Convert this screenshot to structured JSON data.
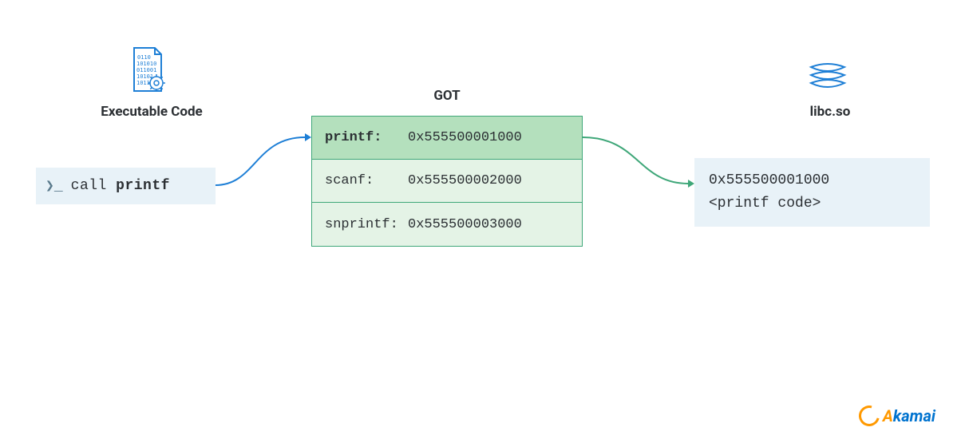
{
  "left": {
    "title": "Executable Code",
    "prompt": "❯_",
    "call_prefix": "call ",
    "call_fn": "printf"
  },
  "got": {
    "title": "GOT",
    "rows": [
      {
        "fn": "printf:",
        "addr": "0x555500001000",
        "active": true
      },
      {
        "fn": "scanf:",
        "addr": "0x555500002000",
        "active": false
      },
      {
        "fn": "snprintf:",
        "addr": "0x555500003000",
        "active": false
      }
    ]
  },
  "right": {
    "title": "libc.so",
    "addr": "0x555500001000",
    "code": "<printf code>"
  },
  "logo": {
    "text": "Akamai"
  },
  "icons": {
    "exec": "binary-file-gear-icon",
    "libc": "stack-layers-icon"
  },
  "colors": {
    "blue": "#1e7fd6",
    "green_border": "#3fa779",
    "green_row": "#e4f3e6",
    "green_row_active": "#b4e0bd",
    "lightblue_box": "#e8f2f8",
    "logo_orange": "#ff9900",
    "logo_blue": "#0073cf"
  }
}
